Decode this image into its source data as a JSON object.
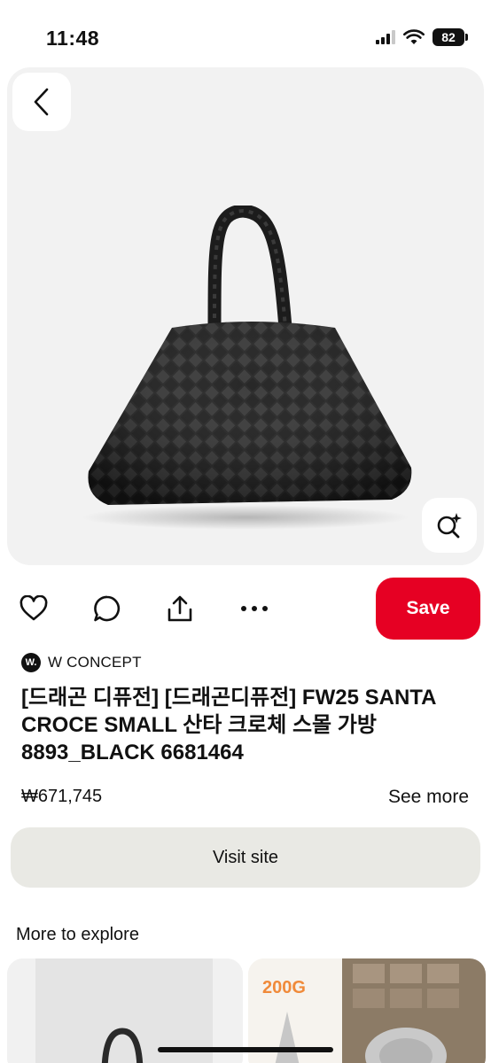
{
  "status_bar": {
    "time": "11:48",
    "battery": "82"
  },
  "pin": {
    "source": {
      "logo_text": "W.",
      "name": "W CONCEPT"
    },
    "title": "[드래곤 디퓨전] [드래곤디퓨전] FW25 SANTA CROCE SMALL 산타 크로체 스몰 가방 8893_BLACK 6681464",
    "price": "₩671,745",
    "see_more_label": "See more"
  },
  "actions": {
    "save_label": "Save",
    "icons": [
      "heart-icon",
      "comment-icon",
      "share-icon",
      "more-icon"
    ]
  },
  "visit_site_label": "Visit site",
  "more_to_explore": {
    "heading": "More to explore",
    "cards": [
      {
        "badge": ""
      },
      {
        "badge": "200G"
      }
    ]
  },
  "colors": {
    "save": "#e60023",
    "visit_bg": "#e9e9e4",
    "hero_bg": "#f2f2f2"
  }
}
